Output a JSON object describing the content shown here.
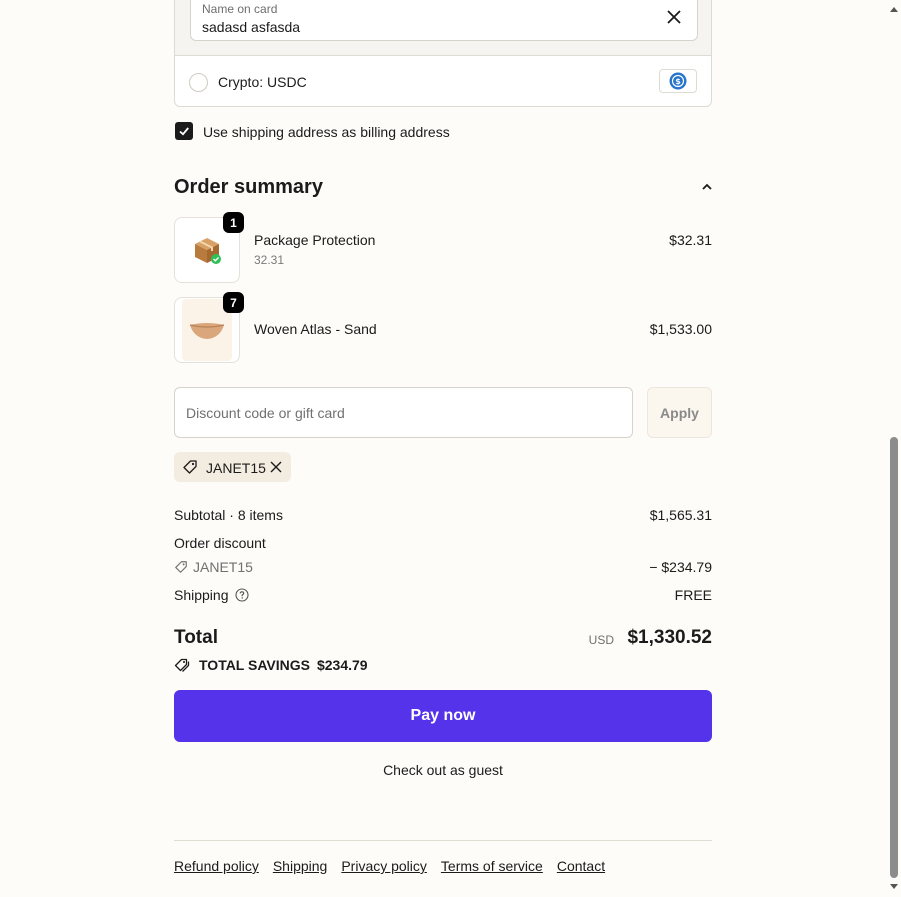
{
  "payment": {
    "name_on_card_label": "Name on card",
    "name_on_card_value": "sadasd asfasda",
    "crypto_label": "Crypto: USDC"
  },
  "billing": {
    "same_as_shipping_label": "Use shipping address as billing address",
    "checked": true
  },
  "summary": {
    "title": "Order summary",
    "items": [
      {
        "name": "Package Protection",
        "sub": "32.31",
        "price": "$32.31",
        "qty": "1",
        "icon": "package-box-icon"
      },
      {
        "name": "Woven Atlas - Sand",
        "price": "$1,533.00",
        "qty": "7",
        "icon": "woven-basket-image"
      }
    ],
    "discount_placeholder": "Discount code or gift card",
    "apply_label": "Apply",
    "applied_code": "JANET15",
    "subtotal_label": "Subtotal · 8 items",
    "subtotal_value": "$1,565.31",
    "order_discount_label": "Order discount",
    "discount_code": "JANET15",
    "discount_value": "− $234.79",
    "shipping_label": "Shipping",
    "shipping_value": "FREE",
    "total_label": "Total",
    "total_currency": "USD",
    "total_value": "$1,330.52",
    "savings_label": "TOTAL SAVINGS",
    "savings_value": "$234.79"
  },
  "actions": {
    "pay_label": "Pay now",
    "guest_label": "Check out as guest"
  },
  "footer": {
    "links": [
      "Refund policy",
      "Shipping",
      "Privacy policy",
      "Terms of service",
      "Contact"
    ]
  },
  "colors": {
    "pay_button": "#5433eb",
    "background": "#fdfcf9",
    "usdc_blue": "#2775ca"
  }
}
